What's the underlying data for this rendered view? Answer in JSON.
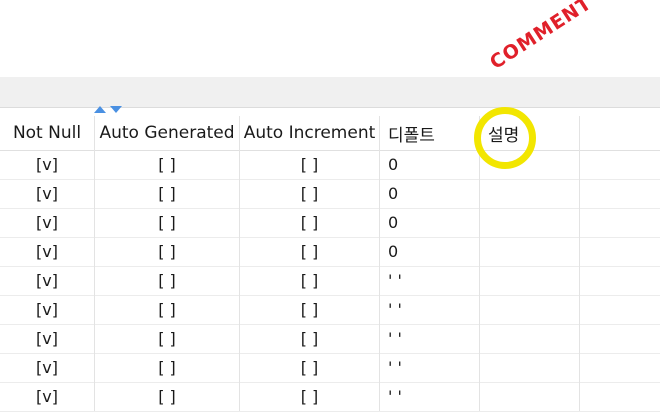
{
  "columns": {
    "not_null": "Not Null",
    "auto_generated": "Auto Generated",
    "auto_increment": "Auto Increment",
    "default": "디폴트",
    "comment": "설명"
  },
  "rows": [
    {
      "not_null": "[v]",
      "auto_generated": "[ ]",
      "auto_increment": "[ ]",
      "default": "0",
      "comment": ""
    },
    {
      "not_null": "[v]",
      "auto_generated": "[ ]",
      "auto_increment": "[ ]",
      "default": "0",
      "comment": ""
    },
    {
      "not_null": "[v]",
      "auto_generated": "[ ]",
      "auto_increment": "[ ]",
      "default": "0",
      "comment": ""
    },
    {
      "not_null": "[v]",
      "auto_generated": "[ ]",
      "auto_increment": "[ ]",
      "default": "0",
      "comment": ""
    },
    {
      "not_null": "[v]",
      "auto_generated": "[ ]",
      "auto_increment": "[ ]",
      "default": "' '",
      "comment": ""
    },
    {
      "not_null": "[v]",
      "auto_generated": "[ ]",
      "auto_increment": "[ ]",
      "default": "' '",
      "comment": ""
    },
    {
      "not_null": "[v]",
      "auto_generated": "[ ]",
      "auto_increment": "[ ]",
      "default": "' '",
      "comment": ""
    },
    {
      "not_null": "[v]",
      "auto_generated": "[ ]",
      "auto_increment": "[ ]",
      "default": "' '",
      "comment": ""
    },
    {
      "not_null": "[v]",
      "auto_generated": "[ ]",
      "auto_increment": "[ ]",
      "default": "' '",
      "comment": ""
    }
  ],
  "annotation": {
    "label": "COMMENT",
    "label_color": "#e0202a",
    "circle_color": "#f2e600"
  },
  "icons": {
    "sort": "sort-arrows-icon"
  }
}
